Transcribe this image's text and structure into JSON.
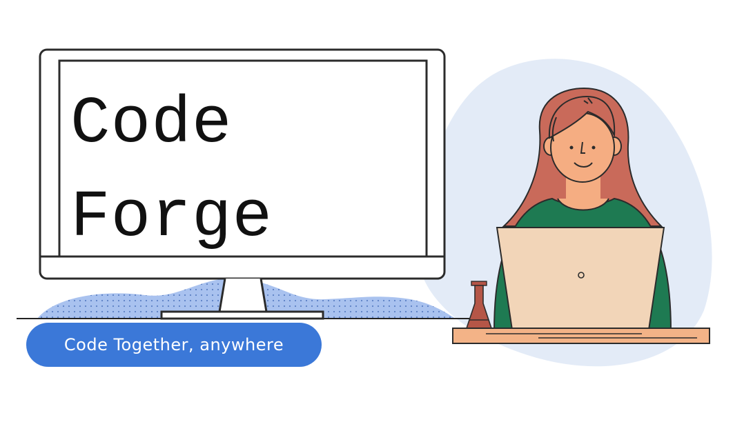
{
  "hero": {
    "title_line1": "Code",
    "title_line2": "Forge",
    "tagline": "Code Together, anywhere"
  },
  "colors": {
    "accent": "#3b78d8",
    "blob": "#e3ebf7",
    "pattern": "#a9c2ef",
    "hair": "#c96a5a",
    "skin": "#f5ad82",
    "sweater": "#1e7a52",
    "laptop": "#f2d5b8",
    "desk": "#f3b387",
    "flask": "#b55647"
  },
  "icons": {
    "monitor": "monitor-icon",
    "person": "person-illustration",
    "laptop": "laptop-icon",
    "flask": "flask-icon"
  }
}
